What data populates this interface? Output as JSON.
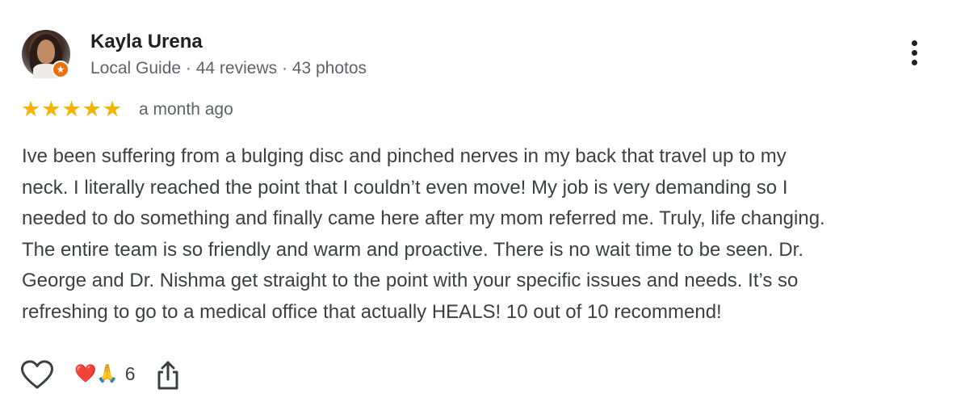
{
  "reviewer": {
    "name": "Kayla Urena",
    "meta": "Local Guide · 44 reviews · 43 photos",
    "badge_icon": "local-guide-star-badge"
  },
  "rating": {
    "stars": 5,
    "max": 5,
    "star_color": "#f4b400",
    "date": "a month ago"
  },
  "review": {
    "lines": [
      "Ive been suffering from a bulging disc and pinched nerves in my back that travel up to my",
      "neck. I literally reached the point that I couldn’t even move! My job is very demanding so I",
      "needed to do something and finally came here after my mom referred me. Truly, life changing.",
      "The entire team is so friendly and warm and proactive. There is no wait time to be seen. Dr.",
      "George and Dr. Nishma get straight to the point with your specific issues and needs. It’s so",
      "refreshing to go to a medical office that actually HEALS! 10 out of 10 recommend!"
    ]
  },
  "actions": {
    "like_icon": "heart-outline-icon",
    "reaction_emojis": "❤️🙏",
    "reaction_count": "6",
    "share_icon": "share-icon",
    "more_icon": "more-vertical-icon"
  },
  "colors": {
    "badge": "#e8710a",
    "meta_text": "#5f6368",
    "body_text": "#3c4043"
  }
}
